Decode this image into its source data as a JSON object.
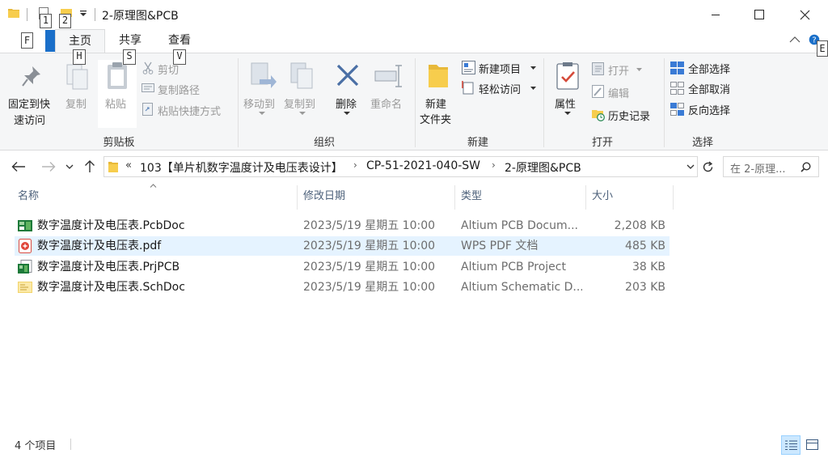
{
  "window": {
    "title": "2-原理图&PCB",
    "quick_access_keytips": [
      "1",
      "2"
    ]
  },
  "ribbon_tabs": {
    "file_keytip": "F",
    "tabs": [
      {
        "label": "主页",
        "keytip": "H"
      },
      {
        "label": "共享",
        "keytip": "S"
      },
      {
        "label": "查看",
        "keytip": "V"
      }
    ],
    "extra_keytip": "E"
  },
  "ribbon": {
    "clipboard": {
      "pin_label_1": "固定到快",
      "pin_label_2": "速访问",
      "copy_label": "复制",
      "paste_label": "粘贴",
      "cut_label": "剪切",
      "copy_path_label": "复制路径",
      "paste_shortcut_label": "粘贴快捷方式",
      "group_label": "剪贴板"
    },
    "organize": {
      "move_to_label": "移动到",
      "copy_to_label": "复制到",
      "delete_label": "删除",
      "rename_label": "重命名",
      "group_label": "组织"
    },
    "new": {
      "new_folder_label_1": "新建",
      "new_folder_label_2": "文件夹",
      "new_item_label": "新建项目",
      "easy_access_label": "轻松访问",
      "group_label": "新建"
    },
    "open": {
      "properties_label": "属性",
      "open_label": "打开",
      "edit_label": "编辑",
      "history_label": "历史记录",
      "group_label": "打开"
    },
    "select": {
      "select_all_label": "全部选择",
      "select_none_label": "全部取消",
      "invert_label": "反向选择",
      "group_label": "选择"
    }
  },
  "address": {
    "overflow": "«",
    "crumbs": [
      "103【单片机数字温度计及电压表设计】",
      "CP-51-2021-040-SW",
      "2-原理图&PCB"
    ],
    "search_placeholder": "在 2-原理..."
  },
  "columns": [
    "名称",
    "修改日期",
    "类型",
    "大小"
  ],
  "files": [
    {
      "name": "数字温度计及电压表.PcbDoc",
      "date": "2023/5/19 星期五 10:00",
      "type": "Altium PCB Docum...",
      "size": "2,208 KB",
      "icon": "pcb-doc-icon"
    },
    {
      "name": "数字温度计及电压表.pdf",
      "date": "2023/5/19 星期五 10:00",
      "type": "WPS PDF 文档",
      "size": "485 KB",
      "icon": "pdf-icon"
    },
    {
      "name": "数字温度计及电压表.PrjPCB",
      "date": "2023/5/19 星期五 10:00",
      "type": "Altium PCB Project",
      "size": "38 KB",
      "icon": "pcb-project-icon"
    },
    {
      "name": "数字温度计及电压表.SchDoc",
      "date": "2023/5/19 星期五 10:00",
      "type": "Altium Schematic D...",
      "size": "203 KB",
      "icon": "schematic-icon"
    }
  ],
  "status": {
    "item_count": "4 个项目"
  },
  "colors": {
    "accent": "#1a6fc9",
    "selected_row": "#e5f3ff",
    "ribbon_bg": "#f5f6f7"
  }
}
